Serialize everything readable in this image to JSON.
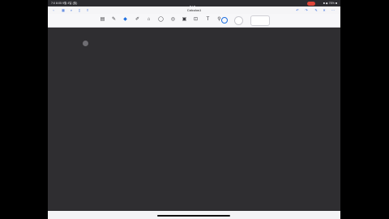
{
  "status_bar": {
    "time": "7:0 8:05   9월 4일 (월)",
    "right": "■ ◆ 76% ■"
  },
  "navbar": {
    "title": "Calculus1",
    "back_icon": "chevron-left-icon",
    "left_icons": [
      "grid-icon",
      "search-icon",
      "bookmark-icon",
      "share-icon"
    ],
    "right_icons": [
      "undo-icon",
      "redo-icon",
      "pen-settings-icon",
      "close-icon",
      "more-icon"
    ]
  },
  "toolbar": {
    "tools": [
      {
        "name": "read-mode-tool",
        "glyph": "▤"
      },
      {
        "name": "pen-tool",
        "glyph": "✎"
      },
      {
        "name": "eraser-tool",
        "glyph": "◆"
      },
      {
        "name": "highlighter-tool",
        "glyph": "✐"
      },
      {
        "name": "shapes-tool",
        "glyph": "⌂"
      },
      {
        "name": "lasso-tool",
        "glyph": "◯"
      },
      {
        "name": "text-box-tool",
        "glyph": "◎"
      },
      {
        "name": "image-tool",
        "glyph": "▣"
      },
      {
        "name": "camera-tool",
        "glyph": "⊡"
      },
      {
        "name": "text-tool",
        "glyph": "T"
      },
      {
        "name": "laser-tool",
        "glyph": "⚲"
      }
    ],
    "active_tool": "eraser-tool",
    "colors": [
      "#1e6fe0",
      "#ffffff"
    ]
  }
}
